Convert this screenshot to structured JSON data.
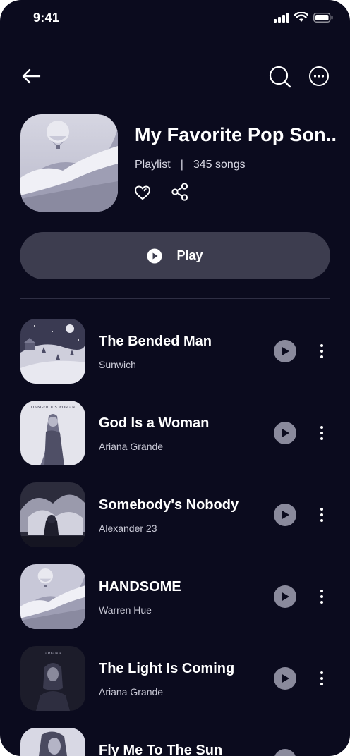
{
  "status_bar": {
    "time": "9:41"
  },
  "playlist": {
    "title": "My Favorite Pop Son..",
    "type": "Playlist",
    "separator": "|",
    "song_count": "345 songs"
  },
  "play_button": {
    "label": "Play"
  },
  "tracks": [
    {
      "title": "The Bended Man",
      "artist": "Sunwich"
    },
    {
      "title": "God Is a Woman",
      "artist": "Ariana Grande",
      "cover_text": "DANGEROUS WOMAN"
    },
    {
      "title": "Somebody's Nobody",
      "artist": "Alexander 23"
    },
    {
      "title": "HANDSOME",
      "artist": "Warren Hue"
    },
    {
      "title": "The Light Is Coming",
      "artist": "Ariana Grande",
      "cover_text": "ARIANA"
    },
    {
      "title": "Fly Me To The Sun",
      "artist": ""
    }
  ],
  "colors": {
    "background": "#0b0b1e",
    "play_button_bg": "#3d3d4f",
    "track_play_bg": "#8a8a9c",
    "text": "#ffffff"
  },
  "icons": [
    "back-arrow-icon",
    "search-icon",
    "more-options-icon",
    "heart-icon",
    "share-icon",
    "play-icon",
    "vertical-dots-icon"
  ]
}
